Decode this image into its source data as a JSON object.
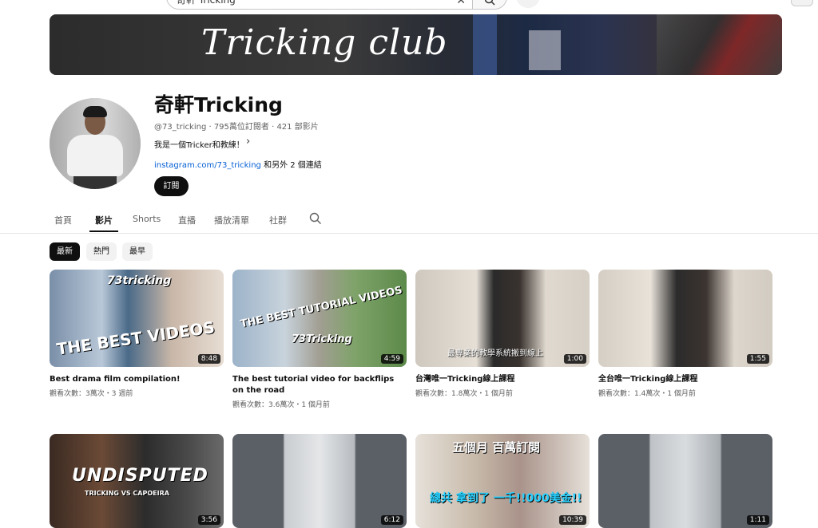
{
  "search": {
    "query": "奇軒 Tricking"
  },
  "banner": {
    "title": "Tricking club"
  },
  "channel": {
    "name": "奇軒Tricking",
    "meta": "@73_tricking · 795萬位訂閱者 · 421 部影片",
    "description": "我是一個Tricker和教練！",
    "link_url": "instagram.com/73_tricking",
    "link_more": " 和另外 2 個連結",
    "subscribe_label": "訂閱"
  },
  "tabs": [
    {
      "label": "首頁"
    },
    {
      "label": "影片"
    },
    {
      "label": "Shorts"
    },
    {
      "label": "直播"
    },
    {
      "label": "播放清單"
    },
    {
      "label": "社群"
    }
  ],
  "filters": [
    {
      "label": "最新"
    },
    {
      "label": "熱門"
    },
    {
      "label": "最早"
    }
  ],
  "videos": [
    {
      "title": "Best drama film compilation!",
      "meta": "觀看次數：3萬次・3 週前",
      "duration": "8:48",
      "overlay": "THE BEST VIDEOS",
      "overlay2": "73tricking"
    },
    {
      "title": "The best tutorial video for backflips on the road",
      "meta": "觀看次數：3.6萬次・1 個月前",
      "duration": "4:59",
      "overlay": "THE BEST TUTORIAL VIDEOS",
      "overlay2": "73Tricking"
    },
    {
      "title": "台灣唯一Tricking線上課程",
      "meta": "觀看次數：1.8萬次・1 個月前",
      "duration": "1:00",
      "overlay": "最專業的教學系統搬到線上"
    },
    {
      "title": "全台唯一Tricking線上課程",
      "meta": "觀看次數：1.4萬次・1 個月前",
      "duration": "1:55"
    },
    {
      "duration": "3:56",
      "overlay": "UNDISPUTED",
      "overlay2": "TRICKING VS CAPOEIRA"
    },
    {
      "duration": "6:12"
    },
    {
      "duration": "10:39",
      "overlay": "五個月 百萬訂閱",
      "overlay2": "總共 拿到了 一千!!000美金!!"
    },
    {
      "duration": "1:11"
    }
  ],
  "colors": {
    "accent": "#0f0f0f",
    "link": "#065fd4",
    "meta": "#606060",
    "chip": "#f2f2f2"
  }
}
